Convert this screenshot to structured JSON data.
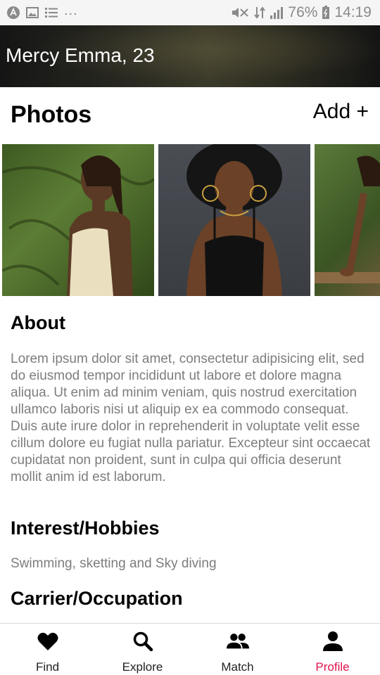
{
  "status_bar": {
    "battery_percent": "76%",
    "time": "14:19",
    "overflow": "...",
    "icons": [
      "app-icon",
      "image-icon",
      "list-icon",
      "mute-icon",
      "data-icon",
      "signal-icon",
      "battery-icon"
    ]
  },
  "header": {
    "name_age": "Mercy Emma, 23"
  },
  "photos": {
    "title": "Photos",
    "add_label": "Add +",
    "items": [
      "photo-1",
      "photo-2",
      "photo-3"
    ]
  },
  "about": {
    "title": "About",
    "text": "Lorem ipsum dolor sit amet, consectetur adipisicing elit, sed do eiusmod tempor incididunt ut labore et dolore magna aliqua. Ut enim ad minim veniam, quis nostrud exercitation ullamco laboris nisi ut aliquip ex ea commodo consequat. Duis aute irure dolor in reprehenderit in voluptate velit esse cillum dolore eu fugiat nulla pariatur. Excepteur sint occaecat cupidatat non proident, sunt in culpa qui officia deserunt mollit anim id est laborum."
  },
  "hobbies": {
    "title": "Interest/Hobbies",
    "text": "Swimming, sketting and Sky diving"
  },
  "occupation": {
    "title": "Carrier/Occupation"
  },
  "bottom_nav": {
    "items": [
      {
        "label": "Find",
        "icon": "heart-icon",
        "active": false
      },
      {
        "label": "Explore",
        "icon": "search-icon",
        "active": false
      },
      {
        "label": "Match",
        "icon": "people-icon",
        "active": false
      },
      {
        "label": "Profile",
        "icon": "person-icon",
        "active": true
      }
    ],
    "active_color": "#e0144c"
  },
  "colors": {
    "text_primary": "#000000",
    "text_secondary": "#7d7d7d",
    "status_bar_bg": "#f5f5f5"
  }
}
